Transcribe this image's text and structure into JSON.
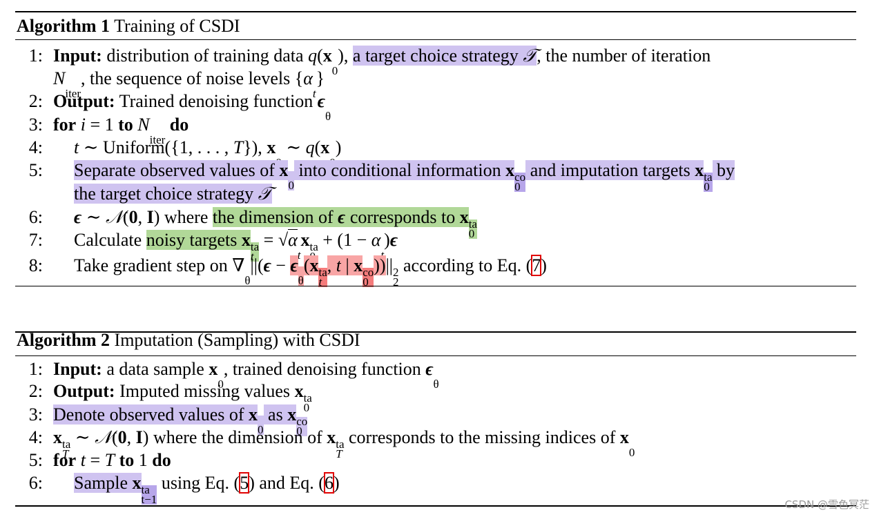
{
  "colors": {
    "purple": "#cfc3f0",
    "purple_dark": "#b7a6ea",
    "green": "#b1d898",
    "red": "#f8a5a5",
    "red_dark": "#f47b7b",
    "cite_box": "#e00000"
  },
  "alg1": {
    "label": "Algorithm 1",
    "title": " Training of CSDI",
    "lines": [
      {
        "num": "1:",
        "segs": [
          {
            "t": "Input:",
            "f": "b"
          },
          {
            "t": " distribution of training data "
          },
          {
            "t": "q",
            "f": "i"
          },
          {
            "t": "("
          },
          {
            "t": "x",
            "f": "mb"
          },
          {
            "sub": "0"
          },
          {
            "t": "), "
          },
          {
            "t": "a target choice strategy ",
            "hl": "p"
          },
          {
            "t": "𝒯",
            "f": "i",
            "hl": "p"
          },
          {
            "t": ", the number of iteration"
          }
        ]
      },
      {
        "num": "",
        "segs": [
          {
            "t": "N",
            "f": "i"
          },
          {
            "sub": "iter"
          },
          {
            "t": ", the sequence of noise levels {"
          },
          {
            "t": "α",
            "f": "i"
          },
          {
            "sub": "t"
          },
          {
            "t": "}"
          }
        ]
      },
      {
        "num": "2:",
        "segs": [
          {
            "t": "Output:",
            "f": "b"
          },
          {
            "t": " Trained denoising function "
          },
          {
            "t": "ϵ",
            "f": "bi"
          },
          {
            "sub": "θ"
          }
        ]
      },
      {
        "num": "3:",
        "segs": [
          {
            "t": "for",
            "f": "b"
          },
          {
            "t": " "
          },
          {
            "t": "i",
            "f": "i"
          },
          {
            "t": " = 1 "
          },
          {
            "t": "to",
            "f": "b"
          },
          {
            "t": " "
          },
          {
            "t": "N",
            "f": "i"
          },
          {
            "sub": "iter"
          },
          {
            "t": " "
          },
          {
            "t": "do",
            "f": "b"
          }
        ]
      },
      {
        "num": "4:",
        "indent": true,
        "segs": [
          {
            "t": "t",
            "f": "i"
          },
          {
            "t": " ∼ Uniform({1, . . . , "
          },
          {
            "t": "T",
            "f": "i"
          },
          {
            "t": "}), "
          },
          {
            "t": "x",
            "f": "mb"
          },
          {
            "sub": "0"
          },
          {
            "t": " ∼ "
          },
          {
            "t": "q",
            "f": "i"
          },
          {
            "t": "("
          },
          {
            "t": "x",
            "f": "mb"
          },
          {
            "sub": "0"
          },
          {
            "t": ")"
          }
        ]
      },
      {
        "num": "5:",
        "indent": true,
        "segs": [
          {
            "t": "Separate observed values of ",
            "hl": "p"
          },
          {
            "t": "x",
            "f": "mb",
            "hl": "p"
          },
          {
            "sub": "0",
            "hl": "p"
          },
          {
            "t": " into conditional information ",
            "hl": "p"
          },
          {
            "t": "x",
            "f": "mb",
            "hl": "p"
          },
          {
            "sub": "0",
            "sup": "co",
            "hl": "p2"
          },
          {
            "t": " and imputation targets ",
            "hl": "p"
          },
          {
            "t": "x",
            "f": "mb",
            "hl": "p"
          },
          {
            "sub": "0",
            "sup": "ta",
            "hl": "p2"
          },
          {
            "t": " by",
            "hl": "p"
          }
        ]
      },
      {
        "num": "",
        "indent": true,
        "segs": [
          {
            "t": "the target choice strategy ",
            "hl": "p"
          },
          {
            "t": "𝒯",
            "f": "i",
            "hl": "p"
          }
        ]
      },
      {
        "num": "6:",
        "indent": true,
        "segs": [
          {
            "t": "ϵ",
            "f": "bi"
          },
          {
            "t": " ∼ "
          },
          {
            "t": "𝒩",
            "f": "i"
          },
          {
            "t": "("
          },
          {
            "t": "0",
            "f": "b"
          },
          {
            "t": ", "
          },
          {
            "t": "I",
            "f": "b"
          },
          {
            "t": ") where "
          },
          {
            "t": "the dimension of ",
            "hl": "g"
          },
          {
            "t": "ϵ",
            "f": "bi",
            "hl": "g"
          },
          {
            "t": " corresponds to ",
            "hl": "g"
          },
          {
            "t": "x",
            "f": "mb",
            "hl": "g"
          },
          {
            "sub": "0",
            "sup": "ta",
            "hl": "g"
          }
        ]
      },
      {
        "num": "7:",
        "indent": true,
        "segs": [
          {
            "t": "Calculate "
          },
          {
            "t": "noisy targets ",
            "hl": "g"
          },
          {
            "t": "x",
            "f": "mb",
            "hl": "g"
          },
          {
            "sub": "t",
            "sup": "ta",
            "hl": "g"
          },
          {
            "t": " = √"
          },
          {
            "t": "α",
            "f": "i",
            "ov": true
          },
          {
            "sub": "t"
          },
          {
            "t": "x",
            "f": "mb"
          },
          {
            "sub": "0",
            "sup": "ta"
          },
          {
            "t": " + (1 − "
          },
          {
            "t": "α",
            "f": "i"
          },
          {
            "sub": "t"
          },
          {
            "t": ")"
          },
          {
            "t": "ϵ",
            "f": "bi"
          }
        ]
      },
      {
        "num": "8:",
        "indent": true,
        "segs": [
          {
            "t": "Take gradient step on ∇"
          },
          {
            "sub": "θ"
          },
          {
            "t": "||("
          },
          {
            "t": "ϵ",
            "f": "bi"
          },
          {
            "t": " − "
          },
          {
            "t": "ϵ",
            "f": "bi",
            "hl": "r"
          },
          {
            "sub": "θ",
            "hl": "r"
          },
          {
            "t": "(",
            "hl": "r"
          },
          {
            "t": "x",
            "f": "mb",
            "hl": "r"
          },
          {
            "sub": "t",
            "sup": "ta",
            "hl": "rd"
          },
          {
            "t": ", ",
            "hl": "r"
          },
          {
            "t": "t",
            "f": "i",
            "hl": "r"
          },
          {
            "t": " | ",
            "hl": "r"
          },
          {
            "t": "x",
            "f": "mb",
            "hl": "r"
          },
          {
            "sub": "0",
            "sup": "co",
            "hl": "rd"
          },
          {
            "t": "))",
            "hl": "r"
          },
          {
            "t": "||"
          },
          {
            "sub": "2",
            "sup": "2"
          },
          {
            "t": " according to Eq. ("
          },
          {
            "t": "7",
            "cite": true
          },
          {
            "t": ")"
          }
        ]
      }
    ]
  },
  "alg2": {
    "label": "Algorithm 2",
    "title": " Imputation (Sampling) with CSDI",
    "lines": [
      {
        "num": "1:",
        "segs": [
          {
            "t": "Input:",
            "f": "b"
          },
          {
            "t": " a data sample "
          },
          {
            "t": "x",
            "f": "mb"
          },
          {
            "sub": "0"
          },
          {
            "t": ", trained denoising function "
          },
          {
            "t": "ϵ",
            "f": "bi"
          },
          {
            "sub": "θ"
          }
        ]
      },
      {
        "num": "2:",
        "segs": [
          {
            "t": "Output:",
            "f": "b"
          },
          {
            "t": " Imputed missing values "
          },
          {
            "t": "x",
            "f": "mb"
          },
          {
            "sub": "0",
            "sup": "ta"
          }
        ]
      },
      {
        "num": "3:",
        "segs": [
          {
            "t": "Denote observed values of ",
            "hl": "p"
          },
          {
            "t": "x",
            "f": "mb",
            "hl": "p"
          },
          {
            "sub": "0",
            "hl": "p"
          },
          {
            "t": " as ",
            "hl": "p"
          },
          {
            "t": "x",
            "f": "mb",
            "hl": "p"
          },
          {
            "sub": "0",
            "sup": "co",
            "hl": "p"
          }
        ]
      },
      {
        "num": "4:",
        "segs": [
          {
            "t": "x",
            "f": "mb"
          },
          {
            "sub": "T",
            "sup": "ta"
          },
          {
            "t": " ∼ "
          },
          {
            "t": "𝒩",
            "f": "i"
          },
          {
            "t": "("
          },
          {
            "t": "0",
            "f": "b"
          },
          {
            "t": ", "
          },
          {
            "t": "I",
            "f": "b"
          },
          {
            "t": ") where the dimension of "
          },
          {
            "t": "x",
            "f": "mb"
          },
          {
            "sub": "T",
            "sup": "ta"
          },
          {
            "t": " corresponds to the missing indices of "
          },
          {
            "t": "x",
            "f": "mb"
          },
          {
            "sub": "0"
          }
        ]
      },
      {
        "num": "5:",
        "segs": [
          {
            "t": "for",
            "f": "b"
          },
          {
            "t": " "
          },
          {
            "t": "t",
            "f": "i"
          },
          {
            "t": " = "
          },
          {
            "t": "T",
            "f": "i"
          },
          {
            "t": " "
          },
          {
            "t": "to",
            "f": "b"
          },
          {
            "t": " 1 "
          },
          {
            "t": "do",
            "f": "b"
          }
        ]
      },
      {
        "num": "6:",
        "indent": true,
        "segs": [
          {
            "t": "Sample ",
            "hl": "p"
          },
          {
            "t": "x",
            "f": "mb",
            "hl": "p"
          },
          {
            "sub": "t−1",
            "sup": "ta",
            "hl": "p2"
          },
          {
            "t": " using Eq. ("
          },
          {
            "t": "5",
            "cite": true
          },
          {
            "t": ") and Eq. ("
          },
          {
            "t": "6",
            "cite": true
          },
          {
            "t": ")"
          }
        ]
      }
    ]
  },
  "watermark": "CSDN @雪色冥茫"
}
